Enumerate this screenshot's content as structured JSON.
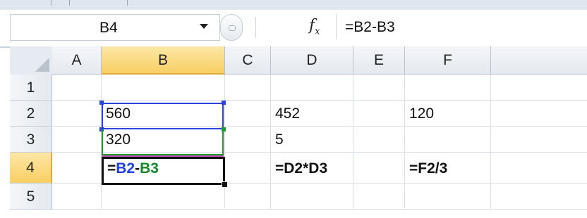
{
  "formula_bar": {
    "name_box": "B4",
    "fx_label": "fx",
    "formula": "=B2-B3"
  },
  "columns": [
    "A",
    "B",
    "C",
    "D",
    "E",
    "F"
  ],
  "rows": [
    "1",
    "2",
    "3",
    "4",
    "5"
  ],
  "active_cell": "B4",
  "cells": {
    "B2": "560",
    "B3": "320",
    "B4_parts": [
      "=",
      "B2",
      "-",
      "B3"
    ],
    "D2": "452",
    "D3": "5",
    "D4": "=D2*D3",
    "F2": "120",
    "F4": "=F2/3"
  },
  "colors": {
    "ref_b2": "#2a44e0",
    "ref_b3": "#1b9a2e",
    "active_header": "#f8cf63"
  }
}
